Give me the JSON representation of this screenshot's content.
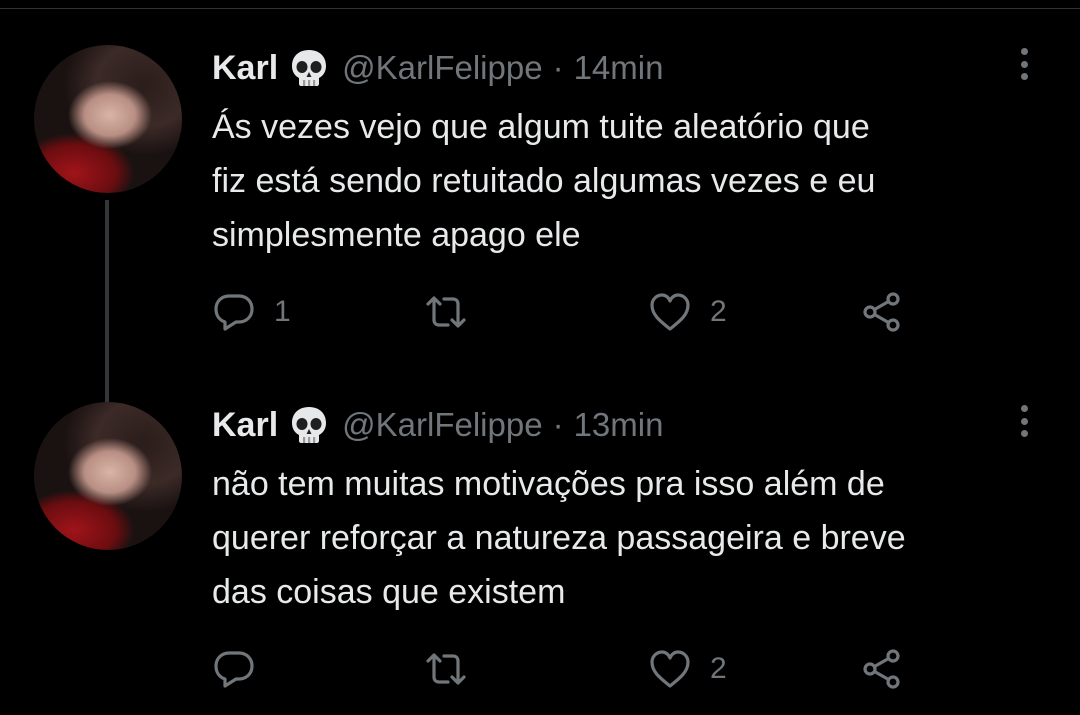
{
  "tweets": [
    {
      "author_name": "Karl",
      "author_emoji": "skull-emoji",
      "handle": "@KarlFelippe",
      "separator": "·",
      "time": "14min",
      "text": "Ás vezes vejo que algum tuite aleatório que\nfiz está sendo retuitado algumas vezes e eu\nsimplesmente apago ele",
      "reply_count": "1",
      "retweet_count": "",
      "like_count": "2"
    },
    {
      "author_name": "Karl",
      "author_emoji": "skull-emoji",
      "handle": "@KarlFelippe",
      "separator": "·",
      "time": "13min",
      "text": "não tem muitas motivações pra isso além de\nquerer reforçar a natureza passageira e breve\ndas coisas que existem",
      "reply_count": "",
      "retweet_count": "",
      "like_count": "2"
    }
  ],
  "icons": {
    "reply": "reply-icon",
    "retweet": "retweet-icon",
    "like": "heart-icon",
    "share": "share-icon",
    "more": "more-options-icon"
  },
  "colors": {
    "background": "#000000",
    "text_primary": "#e7e9ea",
    "text_secondary": "#71767b",
    "thread_line": "#333639"
  }
}
